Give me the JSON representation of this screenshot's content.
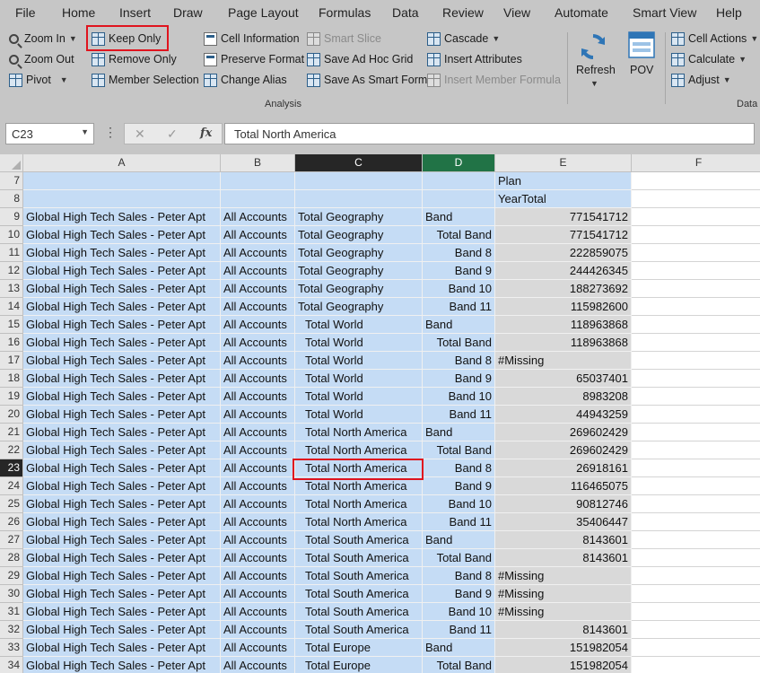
{
  "menu": [
    "File",
    "Home",
    "Insert",
    "Draw",
    "Page Layout",
    "Formulas",
    "Data",
    "Review",
    "View",
    "Automate",
    "Smart View",
    "Help"
  ],
  "ribbon": {
    "col1": [
      {
        "label": "Zoom In",
        "icon": "zoom-in-icon",
        "caret": true
      },
      {
        "label": "Zoom Out",
        "icon": "zoom-out-icon"
      },
      {
        "label": "Pivot",
        "icon": "pivot-icon",
        "caret": true
      }
    ],
    "col2": [
      {
        "label": "Keep Only",
        "icon": "keep-only-icon"
      },
      {
        "label": "Remove Only",
        "icon": "remove-only-icon"
      },
      {
        "label": "Member Selection",
        "icon": "member-selection-icon"
      }
    ],
    "col3": [
      {
        "label": "Cell Information",
        "icon": "cell-information-icon"
      },
      {
        "label": "Preserve Format",
        "icon": "preserve-format-icon"
      },
      {
        "label": "Change Alias",
        "icon": "change-alias-icon"
      }
    ],
    "col4": [
      {
        "label": "Smart Slice",
        "icon": "smart-slice-icon",
        "disabled": true
      },
      {
        "label": "Save Ad Hoc Grid",
        "icon": "save-ad-hoc-grid-icon"
      },
      {
        "label": "Save As Smart Form",
        "icon": "save-as-smart-form-icon"
      }
    ],
    "col5": [
      {
        "label": "Cascade",
        "icon": "cascade-icon",
        "caret": true
      },
      {
        "label": "Insert Attributes",
        "icon": "insert-attributes-icon"
      },
      {
        "label": "Insert Member Formula",
        "icon": "insert-member-formula-icon",
        "disabled": true
      }
    ],
    "refresh": {
      "label": "Refresh"
    },
    "pov": {
      "label": "POV"
    },
    "col6": [
      {
        "label": "Cell Actions",
        "icon": "cell-actions-icon",
        "caret": true
      },
      {
        "label": "Calculate",
        "icon": "calculate-icon",
        "caret": true
      },
      {
        "label": "Adjust",
        "icon": "adjust-icon",
        "caret": true
      }
    ],
    "group_labels": {
      "analysis": "Analysis",
      "data": "Data"
    }
  },
  "formula_bar": {
    "name_box": "C23",
    "fx": "fx",
    "formula": "Total North America"
  },
  "columns": [
    "A",
    "B",
    "C",
    "D",
    "E",
    "F"
  ],
  "rows": [
    {
      "n": "7",
      "a": "",
      "b": "",
      "c": "",
      "d": "",
      "e": "Plan"
    },
    {
      "n": "8",
      "a": "",
      "b": "",
      "c": "",
      "d": "",
      "e": "YearTotal"
    },
    {
      "n": "9",
      "a": "Global High Tech Sales - Peter Apt",
      "b": "All Accounts",
      "c": "Total Geography",
      "d": "Band",
      "e": "771541712"
    },
    {
      "n": "10",
      "a": "Global High Tech Sales - Peter Apt",
      "b": "All Accounts",
      "c": "Total Geography",
      "d": "Total Band",
      "e": "771541712"
    },
    {
      "n": "11",
      "a": "Global High Tech Sales - Peter Apt",
      "b": "All Accounts",
      "c": "Total Geography",
      "d": "Band 8",
      "e": "222859075"
    },
    {
      "n": "12",
      "a": "Global High Tech Sales - Peter Apt",
      "b": "All Accounts",
      "c": "Total Geography",
      "d": "Band 9",
      "e": "244426345"
    },
    {
      "n": "13",
      "a": "Global High Tech Sales - Peter Apt",
      "b": "All Accounts",
      "c": "Total Geography",
      "d": "Band 10",
      "e": "188273692"
    },
    {
      "n": "14",
      "a": "Global High Tech Sales - Peter Apt",
      "b": "All Accounts",
      "c": "Total Geography",
      "d": "Band 11",
      "e": "115982600"
    },
    {
      "n": "15",
      "a": "Global High Tech Sales - Peter Apt",
      "b": "All Accounts",
      "c": "Total World",
      "d": "Band",
      "e": "118963868"
    },
    {
      "n": "16",
      "a": "Global High Tech Sales - Peter Apt",
      "b": "All Accounts",
      "c": "Total World",
      "d": "Total Band",
      "e": "118963868"
    },
    {
      "n": "17",
      "a": "Global High Tech Sales - Peter Apt",
      "b": "All Accounts",
      "c": "Total World",
      "d": "Band 8",
      "e": "#Missing"
    },
    {
      "n": "18",
      "a": "Global High Tech Sales - Peter Apt",
      "b": "All Accounts",
      "c": "Total World",
      "d": "Band 9",
      "e": "65037401"
    },
    {
      "n": "19",
      "a": "Global High Tech Sales - Peter Apt",
      "b": "All Accounts",
      "c": "Total World",
      "d": "Band 10",
      "e": "8983208"
    },
    {
      "n": "20",
      "a": "Global High Tech Sales - Peter Apt",
      "b": "All Accounts",
      "c": "Total World",
      "d": "Band 11",
      "e": "44943259"
    },
    {
      "n": "21",
      "a": "Global High Tech Sales - Peter Apt",
      "b": "All Accounts",
      "c": "Total North America",
      "d": "Band",
      "e": "269602429"
    },
    {
      "n": "22",
      "a": "Global High Tech Sales - Peter Apt",
      "b": "All Accounts",
      "c": "Total North America",
      "d": "Total Band",
      "e": "269602429"
    },
    {
      "n": "23",
      "a": "Global High Tech Sales - Peter Apt",
      "b": "All Accounts",
      "c": "Total North America",
      "d": "Band 8",
      "e": "26918161"
    },
    {
      "n": "24",
      "a": "Global High Tech Sales - Peter Apt",
      "b": "All Accounts",
      "c": "Total North America",
      "d": "Band 9",
      "e": "116465075"
    },
    {
      "n": "25",
      "a": "Global High Tech Sales - Peter Apt",
      "b": "All Accounts",
      "c": "Total North America",
      "d": "Band 10",
      "e": "90812746"
    },
    {
      "n": "26",
      "a": "Global High Tech Sales - Peter Apt",
      "b": "All Accounts",
      "c": "Total North America",
      "d": "Band 11",
      "e": "35406447"
    },
    {
      "n": "27",
      "a": "Global High Tech Sales - Peter Apt",
      "b": "All Accounts",
      "c": "Total South America",
      "d": "Band",
      "e": "8143601"
    },
    {
      "n": "28",
      "a": "Global High Tech Sales - Peter Apt",
      "b": "All Accounts",
      "c": "Total South America",
      "d": "Total Band",
      "e": "8143601"
    },
    {
      "n": "29",
      "a": "Global High Tech Sales - Peter Apt",
      "b": "All Accounts",
      "c": "Total South America",
      "d": "Band 8",
      "e": "#Missing"
    },
    {
      "n": "30",
      "a": "Global High Tech Sales - Peter Apt",
      "b": "All Accounts",
      "c": "Total South America",
      "d": "Band 9",
      "e": "#Missing"
    },
    {
      "n": "31",
      "a": "Global High Tech Sales - Peter Apt",
      "b": "All Accounts",
      "c": "Total South America",
      "d": "Band 10",
      "e": "#Missing"
    },
    {
      "n": "32",
      "a": "Global High Tech Sales - Peter Apt",
      "b": "All Accounts",
      "c": "Total South America",
      "d": "Band 11",
      "e": "8143601"
    },
    {
      "n": "33",
      "a": "Global High Tech Sales - Peter Apt",
      "b": "All Accounts",
      "c": "Total Europe",
      "d": "Band",
      "e": "151982054"
    },
    {
      "n": "34",
      "a": "Global High Tech Sales - Peter Apt",
      "b": "All Accounts",
      "c": "Total Europe",
      "d": "Total Band",
      "e": "151982054"
    }
  ],
  "colors": {
    "member_cell": "#c5dcf5",
    "data_cell": "#d9d9d9",
    "highlight": "#e0141e",
    "excel_green": "#217346"
  }
}
